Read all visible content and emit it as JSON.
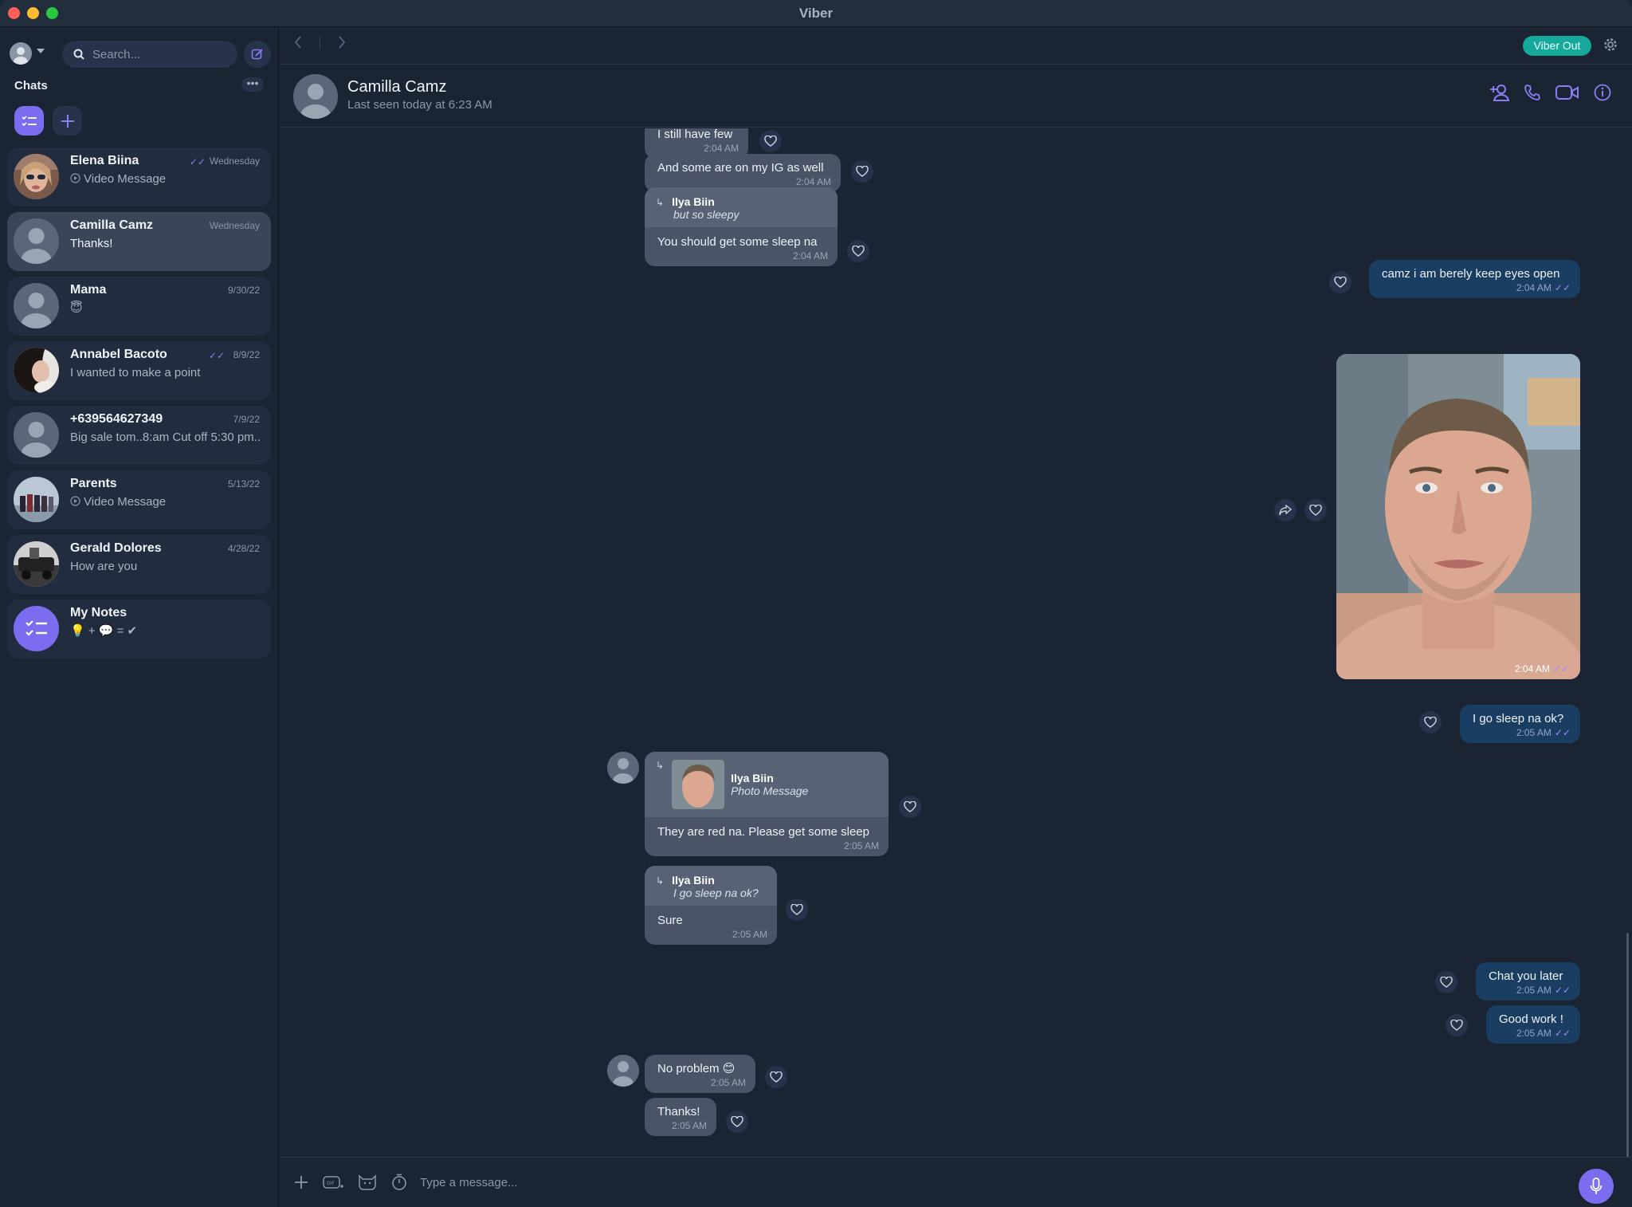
{
  "window": {
    "title": "Viber"
  },
  "sidebar": {
    "search_placeholder": "Search...",
    "chats_label": "Chats",
    "more_label": "•••",
    "chats": [
      {
        "name": "Elena Biina",
        "time": "Wednesday",
        "preview": "Video Message",
        "read": true
      },
      {
        "name": "Camilla Camz",
        "time": "Wednesday",
        "preview": "Thanks!"
      },
      {
        "name": "Mama",
        "time": "9/30/22",
        "preview": "😇"
      },
      {
        "name": "Annabel Bacoto",
        "time": "8/9/22",
        "preview": "I wanted to make a point",
        "read": true
      },
      {
        "name": "+639564627349",
        "time": "7/9/22",
        "preview": "Big sale tom..8:am   Cut off 5:30 pm.."
      },
      {
        "name": "Parents",
        "time": "5/13/22",
        "preview": "Video Message"
      },
      {
        "name": "Gerald Dolores",
        "time": "4/28/22",
        "preview": "How are you"
      },
      {
        "name": "My Notes",
        "time": "",
        "preview": "💡 + 💬 = ✔"
      }
    ]
  },
  "toolbar": {
    "viber_out_label": "Viber Out"
  },
  "chat": {
    "contact_name": "Camilla Camz",
    "last_seen": "Last seen today at 6:23 AM",
    "messages": {
      "m1": {
        "text": "I still have few",
        "time": "2:04 AM"
      },
      "m2": {
        "text": "And some are on my IG as well",
        "time": "2:04 AM"
      },
      "m3": {
        "quote_name": "Ilya Biin",
        "quote_text": "but so sleepy",
        "text": "You should get some sleep na",
        "time": "2:04 AM"
      },
      "m4": {
        "text": "camz i am berely keep eyes open",
        "time": "2:04 AM"
      },
      "m5": {
        "time": "2:04 AM"
      },
      "m6": {
        "text": "I go sleep na ok?",
        "time": "2:05 AM"
      },
      "m7": {
        "quote_name": "Ilya Biin",
        "quote_text": "Photo Message",
        "text": "They are red na. Please get some sleep",
        "time": "2:05 AM"
      },
      "m8": {
        "quote_name": "Ilya Biin",
        "quote_text": "I go sleep na ok?",
        "text": "Sure",
        "time": "2:05 AM"
      },
      "m9": {
        "text": "Chat you later",
        "time": "2:05 AM"
      },
      "m10": {
        "text": "Good work !",
        "time": "2:05 AM"
      },
      "m11": {
        "text": "No problem 😊",
        "time": "2:05 AM"
      },
      "m12": {
        "text": "Thanks!",
        "time": "2:05 AM"
      }
    }
  },
  "composer": {
    "placeholder": "Type a message..."
  },
  "colors": {
    "accent": "#7c6cf0",
    "viber_out": "#16a89a",
    "outgoing": "#1a3d62",
    "incoming": "#4a5466"
  }
}
